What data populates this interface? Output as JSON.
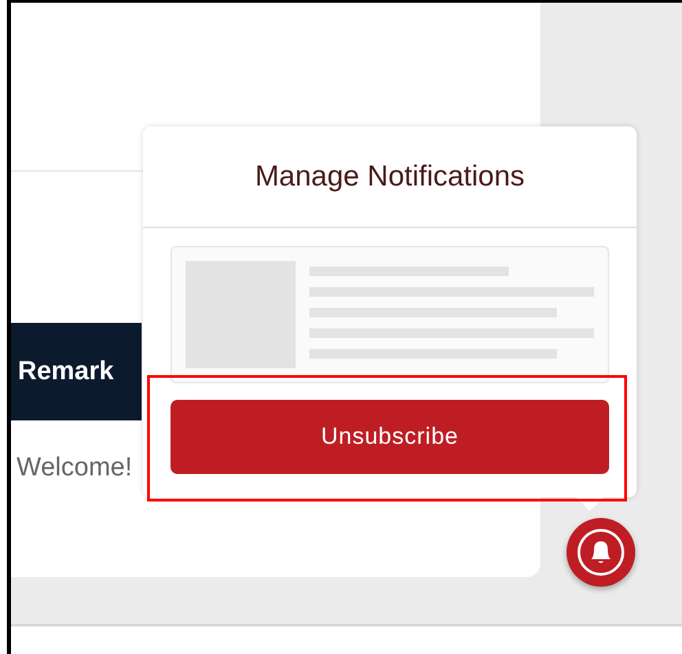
{
  "page": {
    "table_header": "Remark",
    "message": "Welcome!"
  },
  "popup": {
    "title": "Manage Notifications",
    "button": "Unsubscribe",
    "highlighted": true
  }
}
